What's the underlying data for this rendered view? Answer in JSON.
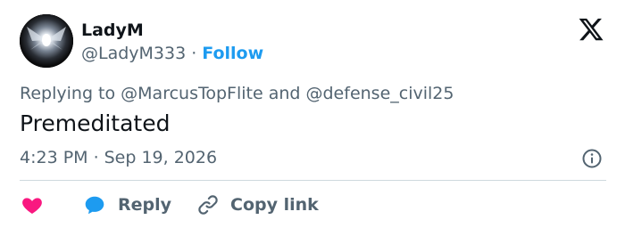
{
  "user": {
    "display_name": "LadyM",
    "handle": "@LadyM333",
    "separator": "·",
    "follow_label": "Follow"
  },
  "reply_context": {
    "prefix": "Replying to ",
    "user1": "@MarcusTopFlite",
    "joiner": " and ",
    "user2": "@defense_civil25"
  },
  "tweet": {
    "text": "Premeditated"
  },
  "meta": {
    "time": "4:23 PM",
    "separator": "·",
    "date": "Sep 19, 2026"
  },
  "actions": {
    "reply_label": "Reply",
    "copy_link_label": "Copy link"
  },
  "icons": {
    "brand": "x-logo-icon",
    "info": "info-icon",
    "like": "heart-icon",
    "reply": "speech-bubble-icon",
    "copy": "link-icon"
  },
  "colors": {
    "accent": "#1d9bf0",
    "like": "#f91880",
    "secondary_text": "#536471",
    "primary_text": "#0f1419",
    "divider": "#cfd9de"
  }
}
